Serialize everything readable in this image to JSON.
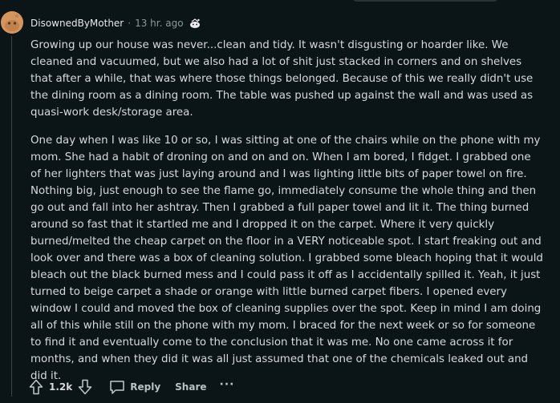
{
  "comment": {
    "author": "DisownedByMother",
    "separator": "·",
    "timestamp": "13 hr. ago",
    "award_icon": "award-icon",
    "paragraphs": [
      "Growing up our house was never...clean and tidy. It wasn't disgusting or hoarder like. We cleaned and vacuumed, but we also had a lot of shit just stacked in corners and on shelves that after a while, that was where those things belonged. Because of this we really didn't use the dining room as a dining room. The table was pushed up against the wall and was used as quasi-work desk/storage area.",
      "One day when I was like 10 or so, I was sitting at one of the chairs while on the phone with my mom. She had a habit of droning on and on and on. When I am bored, I fidget. I grabbed one of her lighters that was just laying around and I was lighting little bits of paper towel on fire. Nothing big, just enough to see the flame go, immediately consume the whole thing and then go out and fall into her ashtray. Then I grabbed a full paper towel and lit it. The thing burned around so fast that it startled me and I dropped it on the carpet. Where it very quickly burned/melted the cheap carpet on the floor in a VERY noticeable spot. I start freaking out and look over and there was a box of cleaning solution. I grabbed some bleach hoping that it would bleach out the black burned mess and I could pass it off as I accidentally spilled it. Yeah, it just turned to beige carpet a shade or orange with little burned carpet fibers. I opened every window I could and moved the box of cleaning supplies over the spot. Keep in mind I am doing all of this while still on the phone with my mom. I braced for the next week or so for someone to find it and eventually come to the conclusion that it was me. No one came across it for months, and when they did it was all just assumed that one of the chemicals leaked out and did it."
    ]
  },
  "actions": {
    "score": "1.2k",
    "reply_label": "Reply",
    "share_label": "Share",
    "more_label": "···"
  },
  "colors": {
    "background": "#0b1416",
    "text": "#d7dadc",
    "muted": "#8b989e",
    "avatar": "#d4955e"
  }
}
